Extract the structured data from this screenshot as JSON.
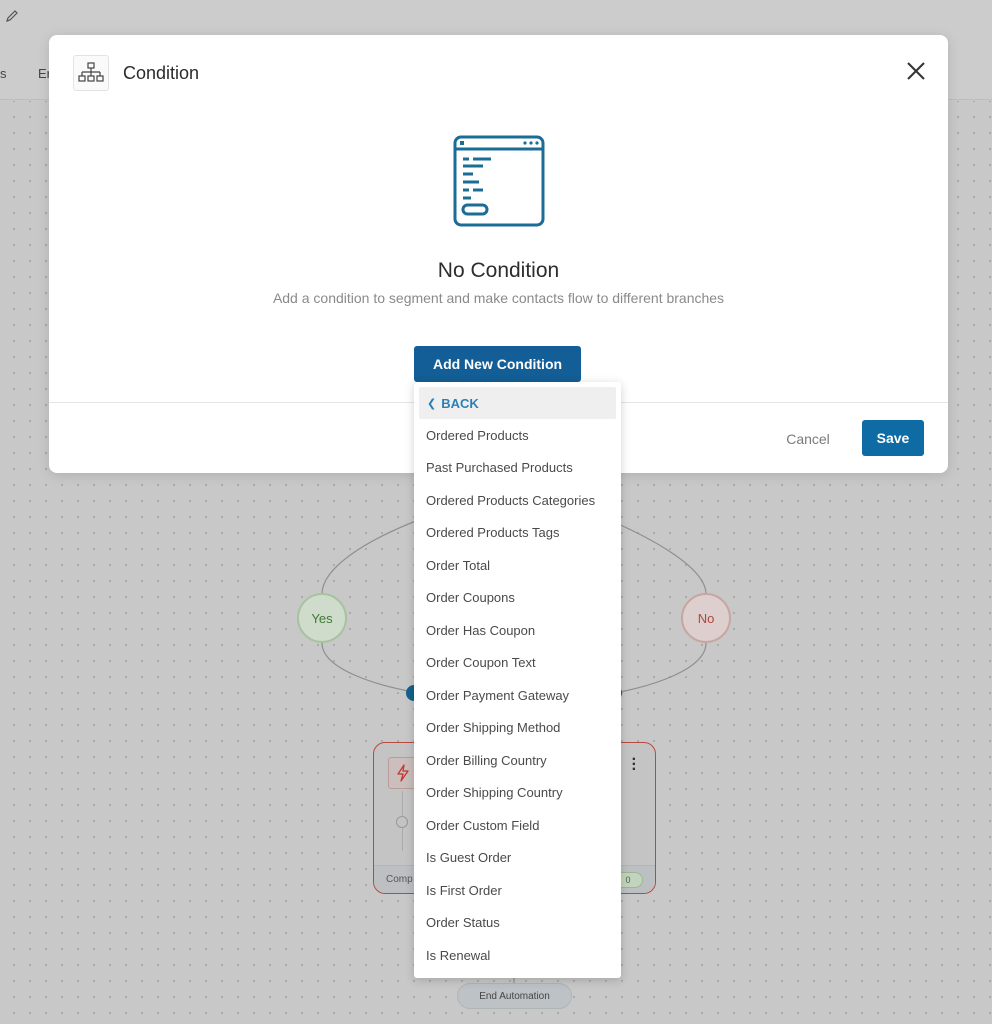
{
  "background": {
    "tabs": [
      {
        "label": "s"
      },
      {
        "label": "Er"
      }
    ],
    "flow": {
      "branches": {
        "yes_label": "Yes",
        "no_label": "No"
      },
      "action_card": {
        "footer_label": "Comp",
        "count": "0"
      },
      "end_node_label": "End Automation"
    }
  },
  "modal": {
    "title": "Condition",
    "empty_state": {
      "title": "No Condition",
      "subtitle": "Add a condition to segment and make contacts flow to different branches"
    },
    "add_button_label": "Add New Condition",
    "cancel_label": "Cancel",
    "save_label": "Save"
  },
  "dropdown": {
    "back_label": "BACK",
    "items": [
      {
        "label": "Ordered Products"
      },
      {
        "label": "Past Purchased Products"
      },
      {
        "label": "Ordered Products Categories"
      },
      {
        "label": "Ordered Products Tags"
      },
      {
        "label": "Order Total"
      },
      {
        "label": "Order Coupons"
      },
      {
        "label": "Order Has Coupon"
      },
      {
        "label": "Order Coupon Text"
      },
      {
        "label": "Order Payment Gateway"
      },
      {
        "label": "Order Shipping Method"
      },
      {
        "label": "Order Billing Country"
      },
      {
        "label": "Order Shipping Country"
      },
      {
        "label": "Order Custom Field"
      },
      {
        "label": "Is Guest Order"
      },
      {
        "label": "Is First Order"
      },
      {
        "label": "Order Status"
      },
      {
        "label": "Is Renewal"
      }
    ]
  },
  "colors": {
    "primary": "#135e96",
    "save": "#0e6ba3",
    "back_link": "#2d7fb5",
    "yes": "#3f7a35",
    "no": "#b2473d",
    "illustration": "#1b6c96"
  }
}
